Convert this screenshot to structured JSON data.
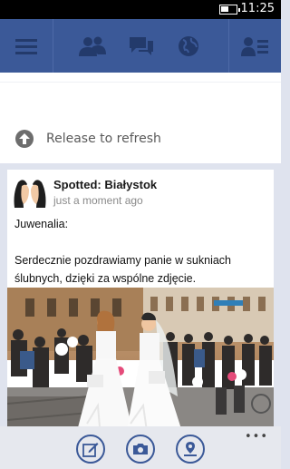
{
  "status_bar": {
    "time": "11:25",
    "battery_icon": "battery-icon"
  },
  "nav": {
    "icons": [
      "menu-icon",
      "friends-icon",
      "messages-icon",
      "notifications-globe-icon",
      "contacts-icon"
    ],
    "accent": "#3b5998"
  },
  "refresh": {
    "label": "Release to refresh",
    "icon": "arrow-up-circle-icon"
  },
  "post": {
    "author": "Spotted: Białystok",
    "time": "just a moment ago",
    "text_line1": "Juwenalia:",
    "text_line2": "Serdecznie pozdrawiamy panie w sukniach ślubnych, dzięki za wspólne zdjęcie."
  },
  "appbar": {
    "icons": [
      "compose-icon",
      "camera-icon",
      "check-in-icon"
    ],
    "more": "•••"
  }
}
